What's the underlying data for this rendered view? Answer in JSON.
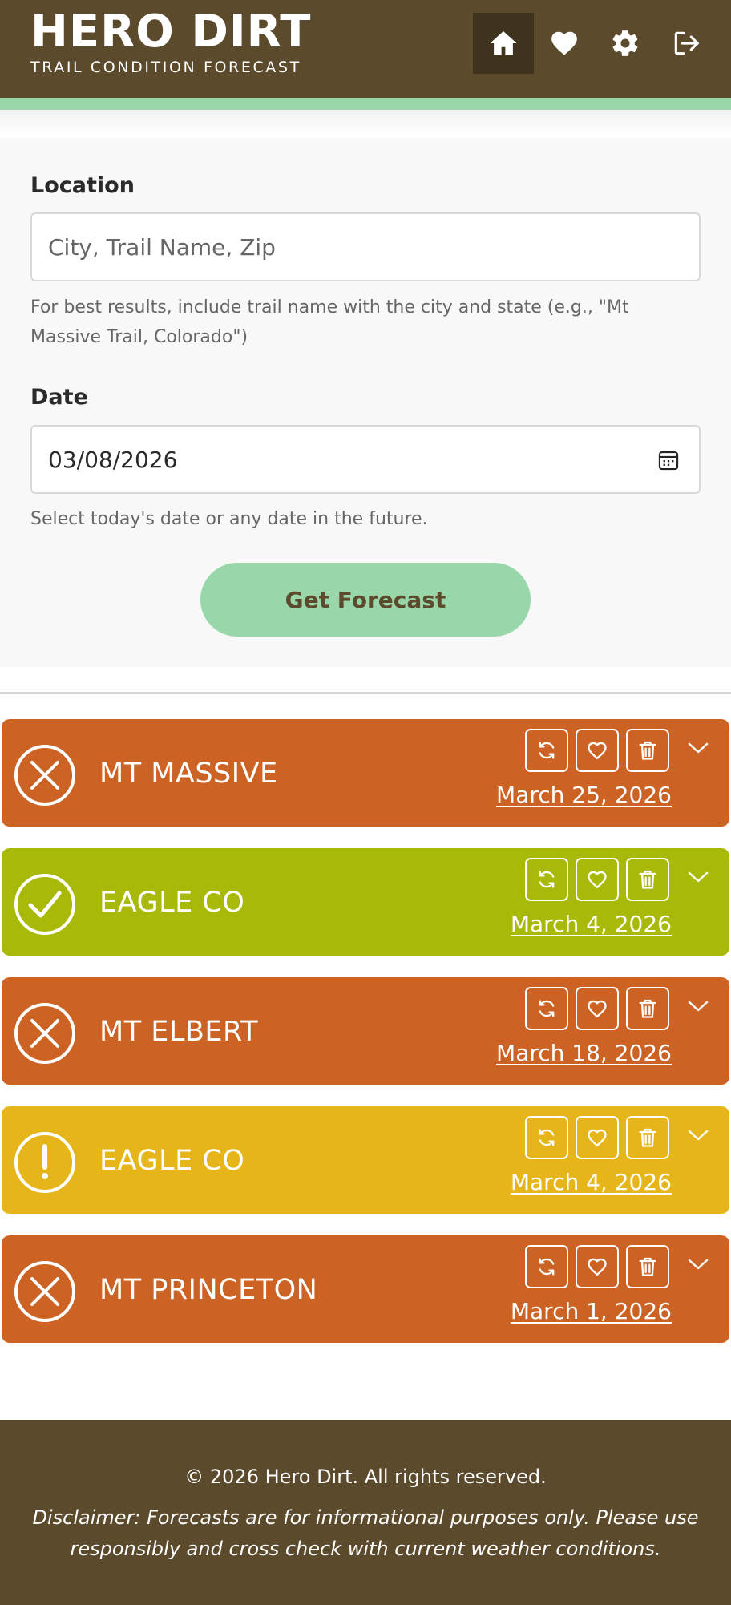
{
  "header": {
    "title": "HERO DIRT",
    "subtitle": "TRAIL CONDITION FORECAST",
    "nav": [
      {
        "icon": "home-icon",
        "active": true
      },
      {
        "icon": "heart-icon",
        "active": false
      },
      {
        "icon": "gear-icon",
        "active": false
      },
      {
        "icon": "logout-icon",
        "active": false
      }
    ]
  },
  "form": {
    "location_label": "Location",
    "location_placeholder": "City, Trail Name, Zip",
    "location_value": "",
    "location_help": "For best results, include trail name with the city and state (e.g., \"Mt Massive Trail, Colorado\")",
    "date_label": "Date",
    "date_value": "03/08/2026",
    "date_help": "Select today's date or any date in the future.",
    "submit_label": "Get Forecast"
  },
  "cards": [
    {
      "name": "MT MASSIVE",
      "date": "March 25, 2026",
      "status": "bad",
      "color": "#cc6223"
    },
    {
      "name": "EAGLE CO",
      "date": "March 4, 2026",
      "status": "good",
      "color": "#a8b90a"
    },
    {
      "name": "MT ELBERT",
      "date": "March 18, 2026",
      "status": "bad",
      "color": "#cc6223"
    },
    {
      "name": "EAGLE CO",
      "date": "March 4, 2026",
      "status": "warning",
      "color": "#e6b51a"
    },
    {
      "name": "MT PRINCETON",
      "date": "March 1, 2026",
      "status": "bad",
      "color": "#cc6223"
    }
  ],
  "footer": {
    "copyright": "© 2026 Hero Dirt. All rights reserved.",
    "disclaimer": "Disclaimer: Forecasts are for informational purposes only. Please use responsibly and cross check with current weather conditions."
  },
  "colors": {
    "brand_brown": "#5c4a2c",
    "accent_green": "#99d7aa",
    "bad": "#cc6223",
    "good": "#a8b90a",
    "warning": "#e6b51a"
  }
}
